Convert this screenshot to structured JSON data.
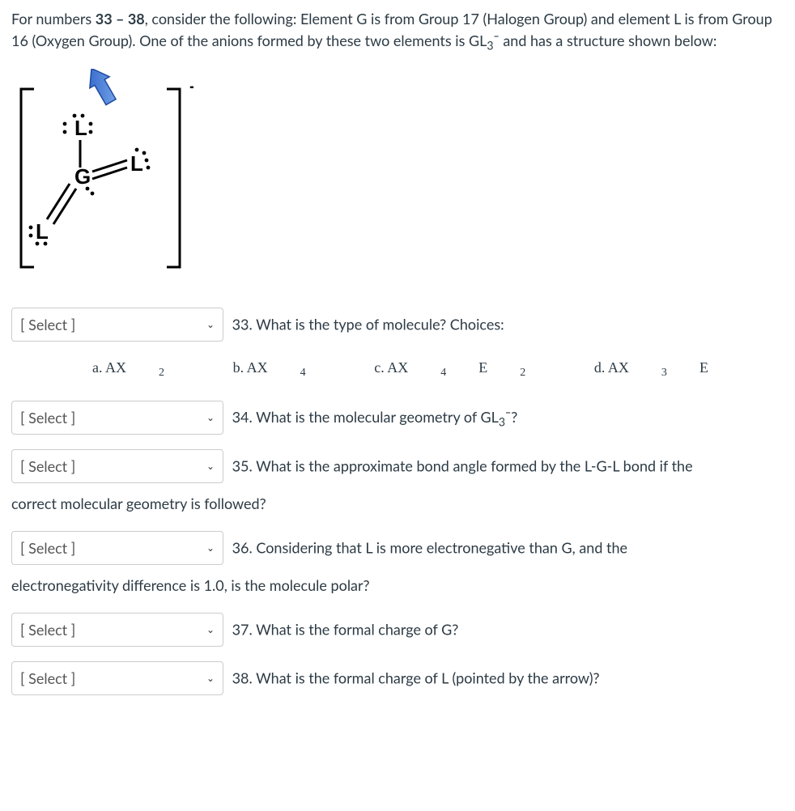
{
  "intro": {
    "prefix": "For numbers ",
    "range": "33 – 38",
    "body1": ", consider the following: Element G is from Group 17 (Halogen Group) and element L is from Group 16 (Oxygen Group).  One of the anions formed by these two elements is GL",
    "sub3": "3",
    "charge": "¯",
    "body2": " and has a structure shown below:"
  },
  "select_placeholder": "[ Select ]",
  "choices": {
    "a_label": "a.  AX",
    "a_sub": "2",
    "b_label": "b.  AX",
    "b_sub": "4",
    "c_label": "c. AX",
    "c_sub1": "4",
    "c_mid": "E",
    "c_sub2": "2",
    "d_label": "d. AX",
    "d_sub1": "3",
    "d_mid": "E"
  },
  "q33": "33. What is the type of molecule? Choices:",
  "q34_a": "34.  What is the molecular geometry of GL",
  "q34_sub": "3",
  "q34_b": "¯?",
  "q35_a": "35. What is the approximate bond angle formed by the L-G-L bond if the",
  "q35_cont": "correct molecular geometry is followed?",
  "q36_a": "36. Considering that L is more electronegative than G, and the",
  "q36_cont": "electronegativity difference is 1.0, is the molecule polar?",
  "q37": "37. What is the formal charge of G?",
  "q38": "38. What is the formal charge of L (pointed by the arrow)?",
  "labels": {
    "G": "G",
    "L_top": "L",
    "L_right": "L",
    "L_bl": "L",
    "minus": "-"
  }
}
